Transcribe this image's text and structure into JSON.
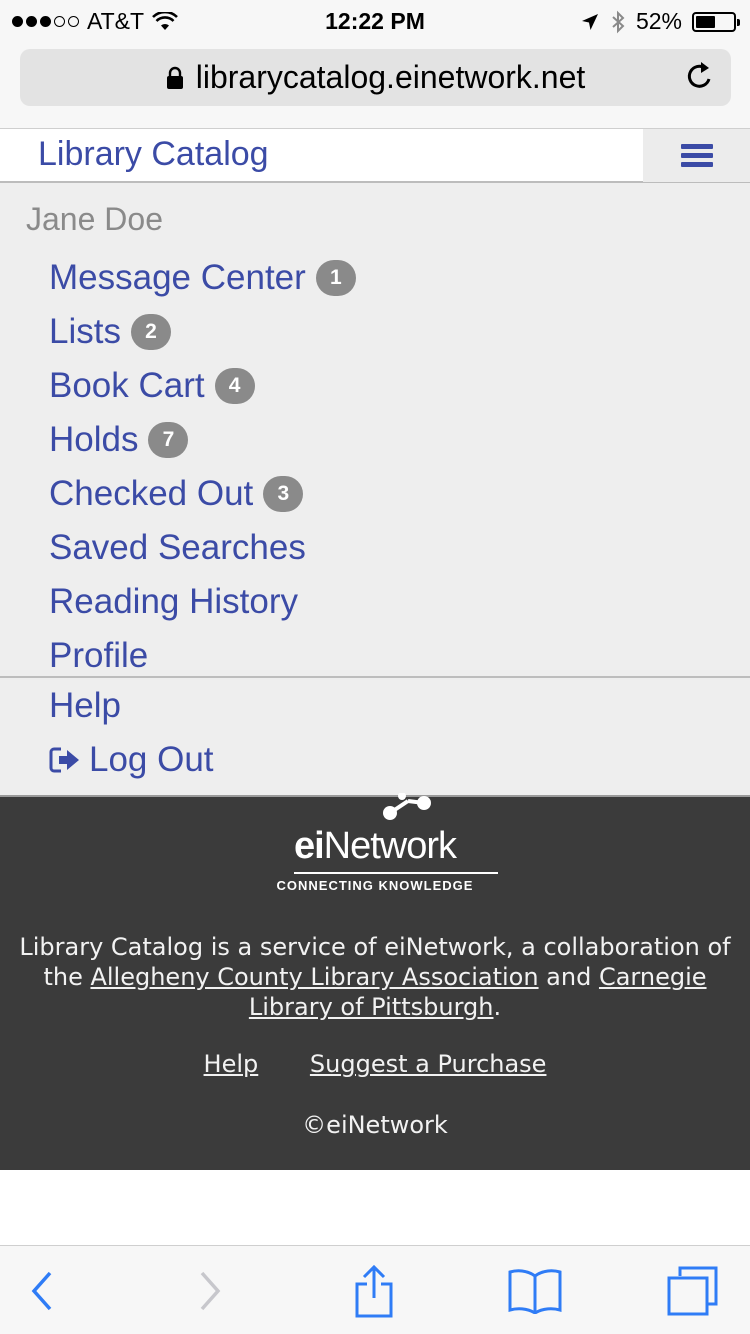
{
  "status_bar": {
    "carrier": "AT&T",
    "time": "12:22 PM",
    "battery_percent_text": "52%",
    "battery_level": 0.52
  },
  "browser": {
    "url": "librarycatalog.einetwork.net"
  },
  "header": {
    "title": "Library Catalog"
  },
  "menu": {
    "user_name": "Jane Doe",
    "items": [
      {
        "label": "Message Center",
        "badge": "1"
      },
      {
        "label": "Lists",
        "badge": "2"
      },
      {
        "label": "Book Cart",
        "badge": "4"
      },
      {
        "label": "Holds",
        "badge": "7"
      },
      {
        "label": "Checked Out",
        "badge": "3"
      },
      {
        "label": "Saved Searches"
      },
      {
        "label": "Reading History"
      },
      {
        "label": "Profile"
      }
    ],
    "secondary": {
      "help": "Help",
      "logout": "Log Out"
    }
  },
  "footer": {
    "logo_ei": "ei",
    "logo_network": "Network",
    "logo_tagline": "CONNECTING KNOWLEDGE",
    "text_prefix": "Library Catalog is a service of eiNetwork, a collaboration of the ",
    "link_allegheny": "Allegheny County Library Association",
    "text_and": " and ",
    "link_carnegie": "Carnegie Library of Pittsburgh",
    "text_suffix": ".",
    "link_help": "Help",
    "link_suggest": "Suggest a Purchase",
    "copyright": "©eiNetwork"
  },
  "colors": {
    "link_blue": "#3b4ba6",
    "badge_gray": "#8a8a8a",
    "footer_bg": "#3b3b3b",
    "ios_blue": "#2f7cf6"
  }
}
